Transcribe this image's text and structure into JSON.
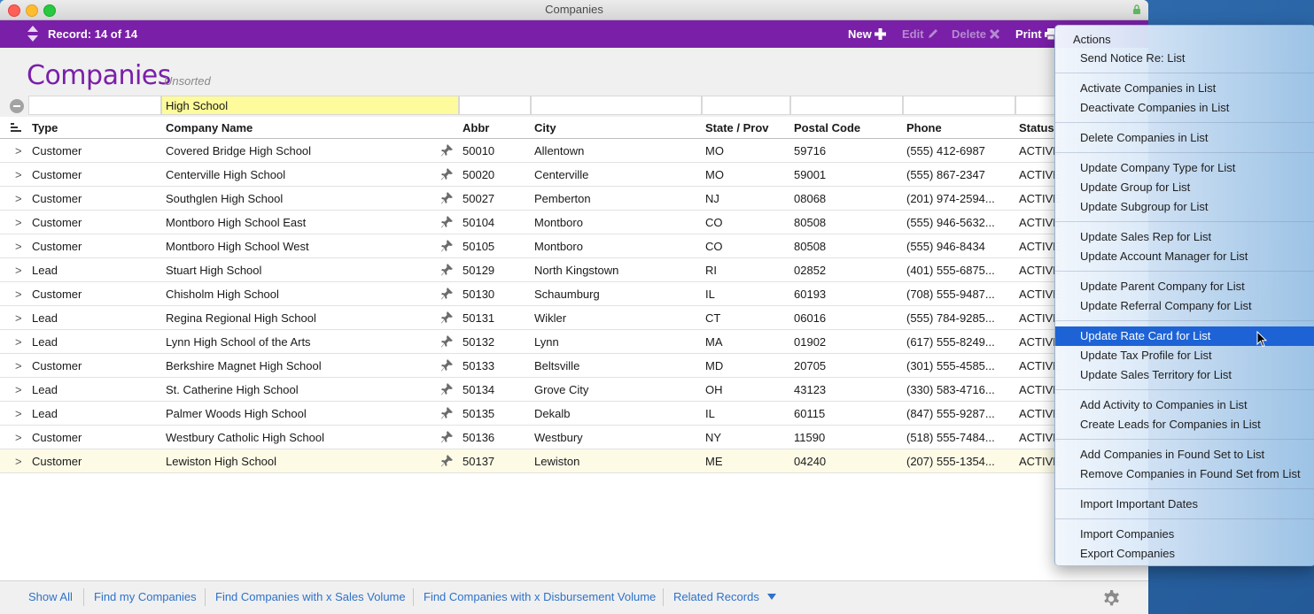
{
  "window": {
    "title": "Companies"
  },
  "toolbar": {
    "record_label": "Record: 14 of 14",
    "new_label": "New",
    "edit_label": "Edit",
    "delete_label": "Delete",
    "print_label": "Print"
  },
  "header": {
    "title": "Companies",
    "sort_status": "Unsorted"
  },
  "find": {
    "company_name": "High School"
  },
  "columns": {
    "type": "Type",
    "company_name": "Company Name",
    "abbr": "Abbr",
    "city": "City",
    "state": "State / Prov",
    "postal": "Postal Code",
    "phone": "Phone",
    "status": "Status"
  },
  "rows": [
    {
      "type": "Customer",
      "name": "Covered Bridge High School",
      "abbr": "50010",
      "city": "Allentown",
      "state": "MO",
      "postal": "59716",
      "phone": "(555) 412-6987",
      "status": "ACTIVE"
    },
    {
      "type": "Customer",
      "name": "Centerville High School",
      "abbr": "50020",
      "city": "Centerville",
      "state": "MO",
      "postal": "59001",
      "phone": "(555) 867-2347",
      "status": "ACTIVE"
    },
    {
      "type": "Customer",
      "name": "Southglen High School",
      "abbr": "50027",
      "city": "Pemberton",
      "state": "NJ",
      "postal": "08068",
      "phone": "(201) 974-2594...",
      "status": "ACTIVE"
    },
    {
      "type": "Customer",
      "name": "Montboro High School East",
      "abbr": "50104",
      "city": "Montboro",
      "state": "CO",
      "postal": "80508",
      "phone": "(555) 946-5632...",
      "status": "ACTIVE"
    },
    {
      "type": "Customer",
      "name": "Montboro High School West",
      "abbr": "50105",
      "city": "Montboro",
      "state": "CO",
      "postal": "80508",
      "phone": "(555) 946-8434",
      "status": "ACTIVE"
    },
    {
      "type": "Lead",
      "name": "Stuart High School",
      "abbr": "50129",
      "city": "North Kingstown",
      "state": "RI",
      "postal": "02852",
      "phone": "(401) 555-6875...",
      "status": "ACTIVE"
    },
    {
      "type": "Customer",
      "name": "Chisholm High School",
      "abbr": "50130",
      "city": "Schaumburg",
      "state": "IL",
      "postal": "60193",
      "phone": "(708) 555-9487...",
      "status": "ACTIVE"
    },
    {
      "type": "Lead",
      "name": "Regina Regional High School",
      "abbr": "50131",
      "city": "Wikler",
      "state": "CT",
      "postal": "06016",
      "phone": "(555) 784-9285...",
      "status": "ACTIVE"
    },
    {
      "type": "Lead",
      "name": "Lynn High School of the Arts",
      "abbr": "50132",
      "city": "Lynn",
      "state": "MA",
      "postal": "01902",
      "phone": "(617) 555-8249...",
      "status": "ACTIVE"
    },
    {
      "type": "Customer",
      "name": "Berkshire Magnet High School",
      "abbr": "50133",
      "city": "Beltsville",
      "state": "MD",
      "postal": "20705",
      "phone": "(301) 555-4585...",
      "status": "ACTIVE"
    },
    {
      "type": "Lead",
      "name": "St. Catherine High School",
      "abbr": "50134",
      "city": "Grove City",
      "state": "OH",
      "postal": "43123",
      "phone": "(330) 583-4716...",
      "status": "ACTIVE"
    },
    {
      "type": "Lead",
      "name": "Palmer Woods High School",
      "abbr": "50135",
      "city": "Dekalb",
      "state": "IL",
      "postal": "60115",
      "phone": "(847) 555-9287...",
      "status": "ACTIVE"
    },
    {
      "type": "Customer",
      "name": "Westbury Catholic High School",
      "abbr": "50136",
      "city": "Westbury",
      "state": "NY",
      "postal": "11590",
      "phone": "(518) 555-7484...",
      "status": "ACTIVE"
    },
    {
      "type": "Customer",
      "name": "Lewiston High School",
      "abbr": "50137",
      "city": "Lewiston",
      "state": "ME",
      "postal": "04240",
      "phone": "(207) 555-1354...",
      "status": "ACTIVE"
    }
  ],
  "row_chevron": ">",
  "footer": {
    "show_all": "Show All",
    "find_my": "Find my Companies",
    "find_sales": "Find Companies with x Sales Volume",
    "find_disb": "Find Companies with x Disbursement Volume",
    "related": "Related Records"
  },
  "menu": {
    "header": "Actions",
    "items": [
      "Send Notice Re: List",
      "Activate Companies in List",
      "Deactivate Companies in List",
      "Delete Companies in List",
      "Update Company Type for List",
      "Update Group for List",
      "Update Subgroup for List",
      "Update Sales Rep for List",
      "Update Account Manager for List",
      "Update Parent Company for List",
      "Update Referral Company for List",
      "Update Rate Card for List",
      "Update Tax Profile for List",
      "Update Sales Territory for List",
      "Add Activity to Companies in List",
      "Create Leads for Companies in List",
      "Add Companies in Found Set to List",
      "Remove Companies in Found Set from List",
      "Import Important Dates",
      "Import Companies",
      "Export Companies"
    ],
    "highlighted": "Update Rate Card for List"
  },
  "colors": {
    "brand": "#7a1fa8",
    "link": "#2e72c9",
    "highlight": "#1d63d6",
    "find_active": "#fdfb9b"
  }
}
